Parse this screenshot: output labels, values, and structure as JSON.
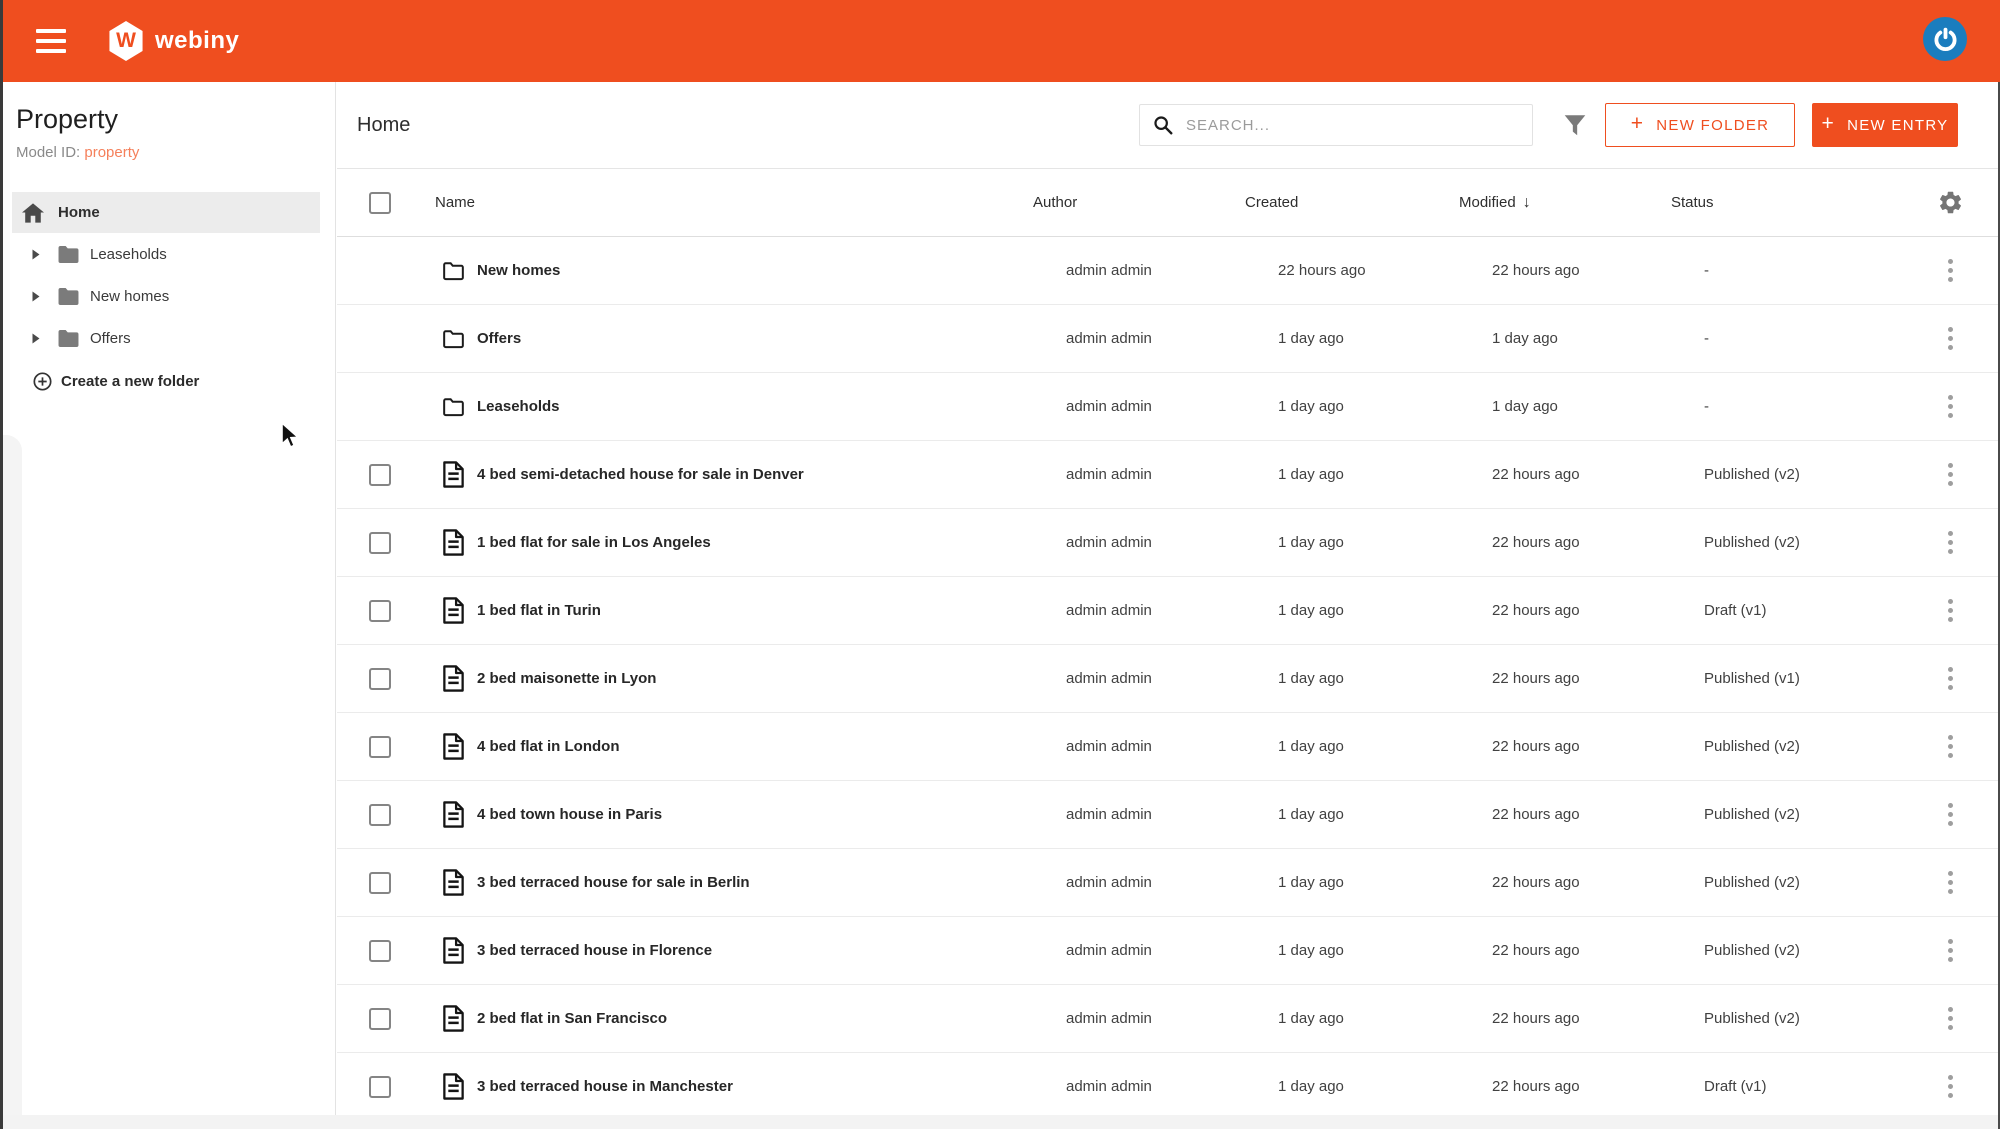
{
  "header": {
    "brand": "webiny",
    "brand_initial": "W"
  },
  "sidebar": {
    "title": "Property",
    "model_id_label": "Model ID:",
    "model_id_value": "property",
    "home_label": "Home",
    "folders": [
      "Leaseholds",
      "New homes",
      "Offers"
    ],
    "create_folder_label": "Create a new folder"
  },
  "toolbar": {
    "title": "Home",
    "search_placeholder": "SEARCH...",
    "plus": "+",
    "new_folder_label": "NEW FOLDER",
    "new_entry_label": "NEW ENTRY"
  },
  "table": {
    "columns": [
      "Name",
      "Author",
      "Created",
      "Modified",
      "Status"
    ],
    "sort_column": "Modified",
    "sort_arrow": "↓",
    "rows": [
      {
        "type": "folder",
        "name": "New homes",
        "author": "admin admin",
        "created": "22 hours ago",
        "modified": "22 hours ago",
        "status": "-"
      },
      {
        "type": "folder",
        "name": "Offers",
        "author": "admin admin",
        "created": "1 day ago",
        "modified": "1 day ago",
        "status": "-"
      },
      {
        "type": "folder",
        "name": "Leaseholds",
        "author": "admin admin",
        "created": "1 day ago",
        "modified": "1 day ago",
        "status": "-"
      },
      {
        "type": "entry",
        "name": "4 bed semi-detached house for sale in Denver",
        "author": "admin admin",
        "created": "1 day ago",
        "modified": "22 hours ago",
        "status": "Published (v2)"
      },
      {
        "type": "entry",
        "name": "1 bed flat for sale in Los Angeles",
        "author": "admin admin",
        "created": "1 day ago",
        "modified": "22 hours ago",
        "status": "Published (v2)"
      },
      {
        "type": "entry",
        "name": "1 bed flat in Turin",
        "author": "admin admin",
        "created": "1 day ago",
        "modified": "22 hours ago",
        "status": "Draft (v1)"
      },
      {
        "type": "entry",
        "name": "2 bed maisonette in Lyon",
        "author": "admin admin",
        "created": "1 day ago",
        "modified": "22 hours ago",
        "status": "Published (v1)"
      },
      {
        "type": "entry",
        "name": "4 bed flat in London",
        "author": "admin admin",
        "created": "1 day ago",
        "modified": "22 hours ago",
        "status": "Published (v2)"
      },
      {
        "type": "entry",
        "name": "4 bed town house in Paris",
        "author": "admin admin",
        "created": "1 day ago",
        "modified": "22 hours ago",
        "status": "Published (v2)"
      },
      {
        "type": "entry",
        "name": "3 bed terraced house for sale in Berlin",
        "author": "admin admin",
        "created": "1 day ago",
        "modified": "22 hours ago",
        "status": "Published (v2)"
      },
      {
        "type": "entry",
        "name": "3 bed terraced house in Florence",
        "author": "admin admin",
        "created": "1 day ago",
        "modified": "22 hours ago",
        "status": "Published (v2)"
      },
      {
        "type": "entry",
        "name": "2 bed flat in San Francisco",
        "author": "admin admin",
        "created": "1 day ago",
        "modified": "22 hours ago",
        "status": "Published (v2)"
      },
      {
        "type": "entry",
        "name": "3 bed terraced house in Manchester",
        "author": "admin admin",
        "created": "1 day ago",
        "modified": "22 hours ago",
        "status": "Draft (v1)"
      }
    ]
  },
  "icons": {
    "menu": "hamburger",
    "avatar": "power-circle",
    "home": "house",
    "tree_caret": "triangle-right",
    "tree_folder": "folder-filled",
    "create_folder": "circle-plus",
    "search": "magnifier",
    "filter": "funnel",
    "settings": "gear",
    "row_folder": "folder-outline",
    "row_entry": "document",
    "more": "kebab-vertical",
    "sort": "arrow-down"
  },
  "colors": {
    "primary": "#EF4E1F",
    "primary_light": "#F5805B",
    "avatar_blue": "#1B7DBE",
    "selected_bg": "#ECECEC"
  }
}
